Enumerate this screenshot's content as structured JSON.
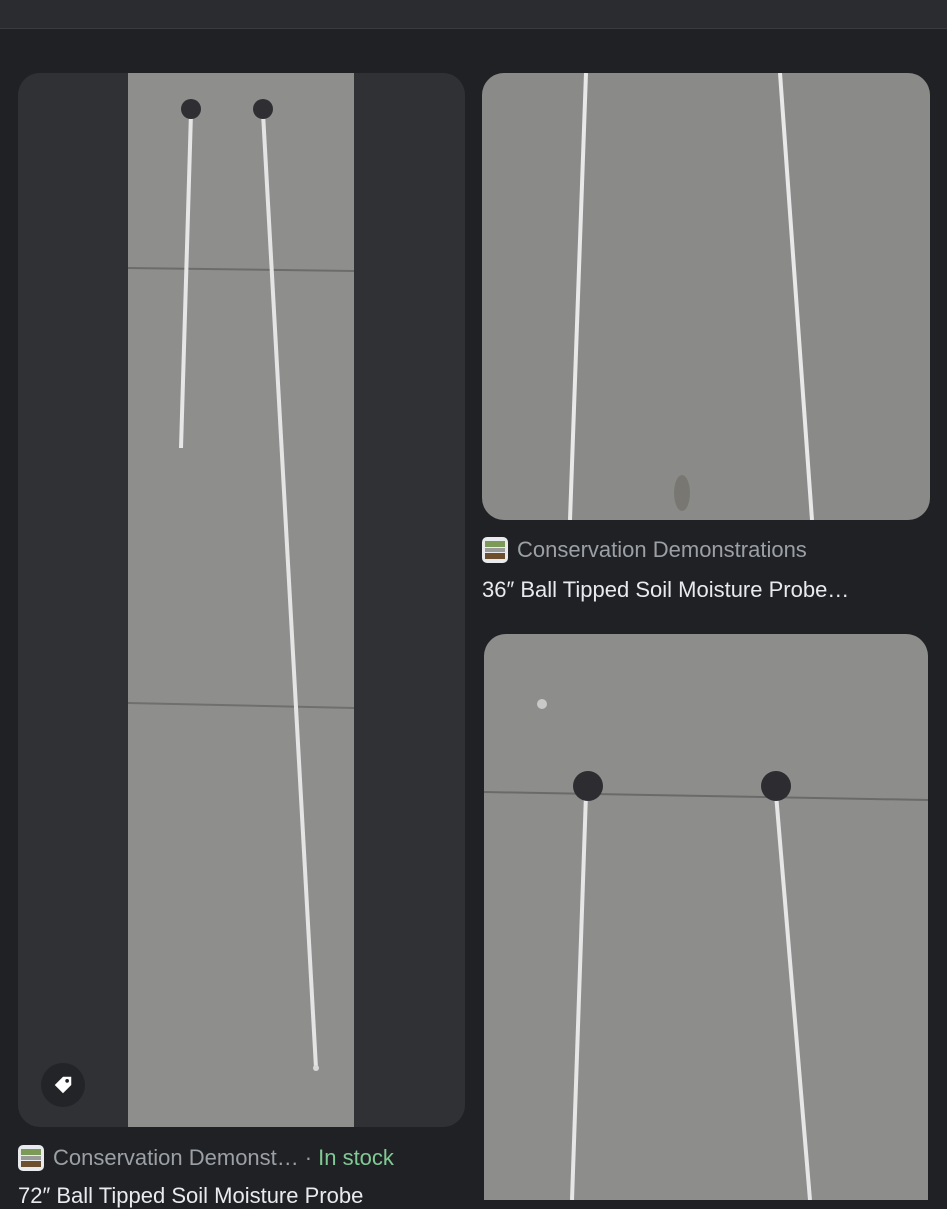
{
  "results": [
    {
      "source": "Conservation Demonst…",
      "availability": "In stock",
      "title": "72″ Ball Tipped Soil Moisture Probe",
      "favicon_icon": "site-favicon",
      "tag_icon": "price-tag-icon"
    },
    {
      "source": "Conservation Demonstrations",
      "title": "36″ Ball Tipped Soil Moisture Probe…",
      "favicon_icon": "site-favicon"
    },
    {
      "source": "",
      "title": ""
    }
  ],
  "colors": {
    "background": "#202124",
    "source_text": "#9aa0a6",
    "title_text": "#e8eaed",
    "in_stock": "#81c995",
    "concrete": "#8f908c"
  }
}
